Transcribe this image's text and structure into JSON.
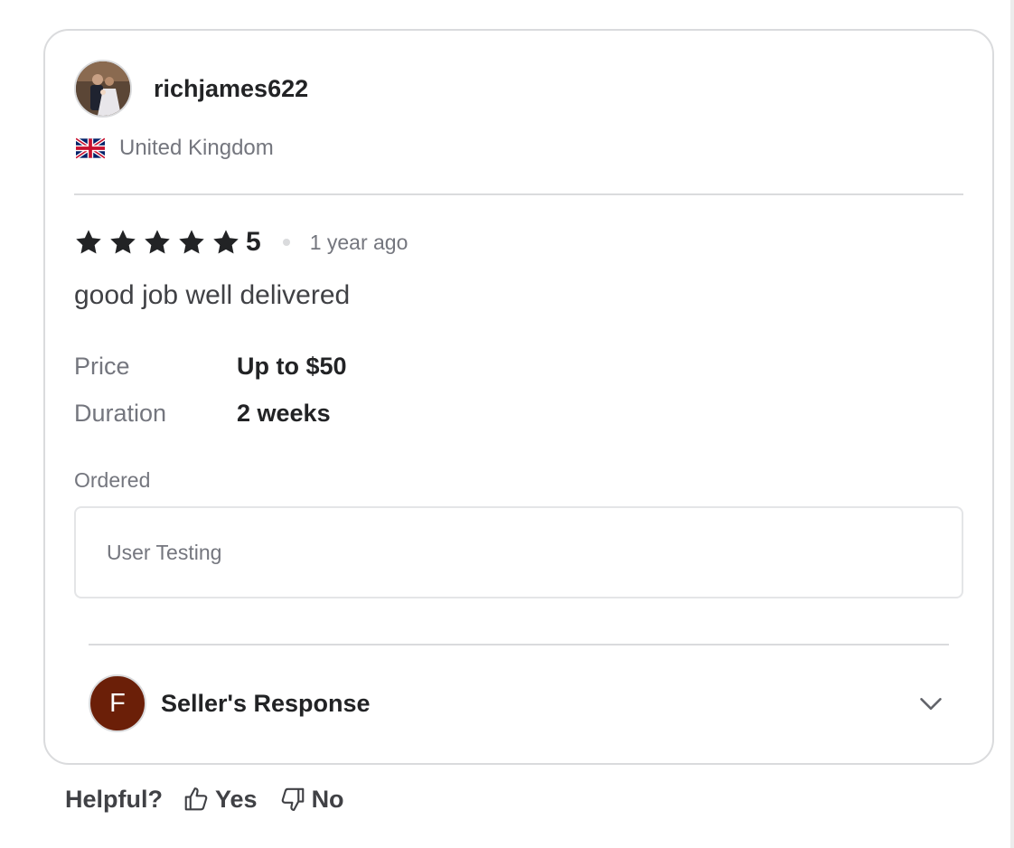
{
  "review": {
    "reviewer": {
      "username": "richjames622",
      "country": "United Kingdom",
      "flag_icon": "uk-flag-icon"
    },
    "rating": {
      "stars": 5,
      "value": "5",
      "time_ago": "1 year ago"
    },
    "text": "good job well delivered",
    "details": {
      "price_label": "Price",
      "price_value": "Up to $50",
      "duration_label": "Duration",
      "duration_value": "2 weeks"
    },
    "ordered": {
      "label": "Ordered",
      "item": "User Testing"
    },
    "seller_response": {
      "avatar_letter": "F",
      "title": "Seller's Response",
      "toggle_icon": "chevron-down-icon"
    }
  },
  "helpful": {
    "label": "Helpful?",
    "yes_label": "Yes",
    "no_label": "No",
    "yes_icon": "thumbs-up-icon",
    "no_icon": "thumbs-down-icon"
  },
  "colors": {
    "star": "#222325",
    "seller_avatar_bg": "#6b1f08",
    "muted_text": "#74767e",
    "border": "#dadbdd"
  }
}
